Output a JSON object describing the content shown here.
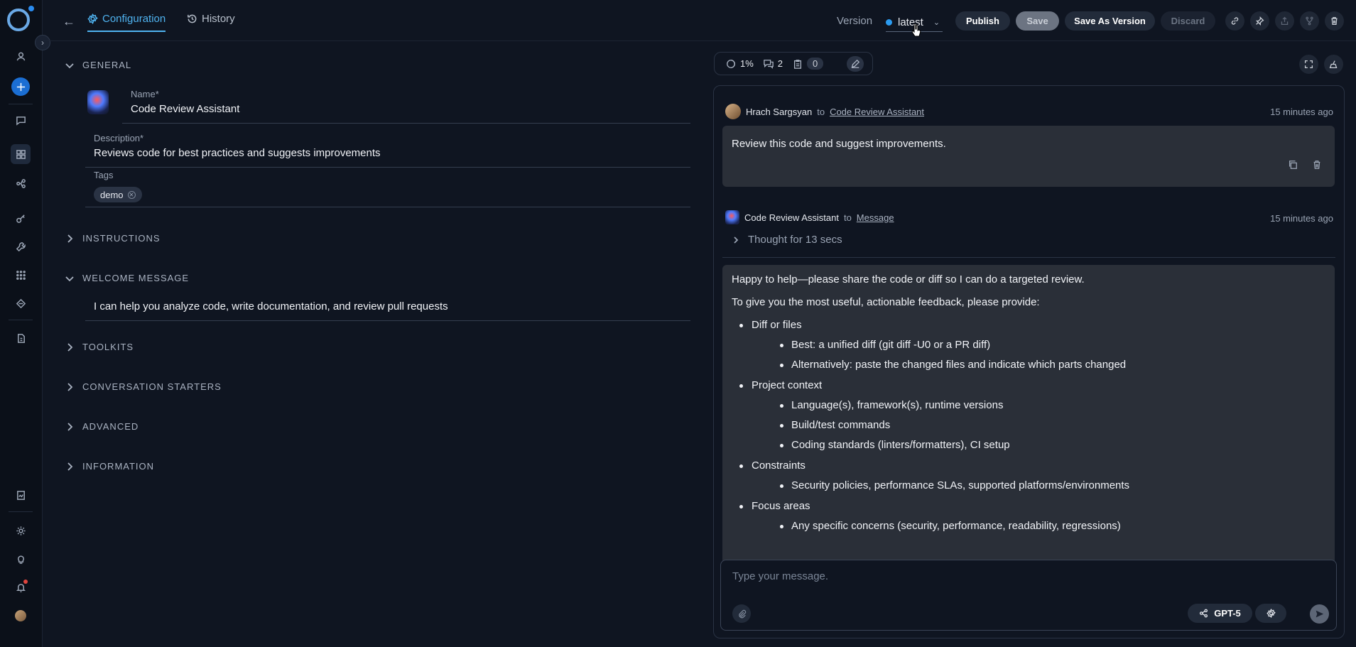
{
  "topbar": {
    "tabs": [
      {
        "label": "Configuration"
      },
      {
        "label": "History"
      }
    ],
    "version_label": "Version",
    "version_value": "latest",
    "buttons": {
      "publish": "Publish",
      "save": "Save",
      "save_as": "Save As Version",
      "discard": "Discard"
    }
  },
  "config": {
    "sections": {
      "general": "GENERAL",
      "instructions": "INSTRUCTIONS",
      "welcome": "WELCOME MESSAGE",
      "toolkits": "TOOLKITS",
      "starters": "CONVERSATION STARTERS",
      "advanced": "ADVANCED",
      "information": "INFORMATION"
    },
    "name_label": "Name",
    "name_value": "Code Review Assistant",
    "description_label": "Description",
    "description_value": "Reviews code for best practices and suggests improvements",
    "tags_label": "Tags",
    "tags": [
      "demo"
    ],
    "welcome_message": "I can help you analyze code, write documentation, and review pull requests",
    "required_mark": "*"
  },
  "chat_tools": {
    "context": "1%",
    "messages": "2",
    "attachments": "0"
  },
  "chat": {
    "user_message": {
      "author": "Hrach Sargsyan",
      "to": "to",
      "target": "Code Review Assistant",
      "time": "15 minutes ago",
      "text": "Review this code and suggest improvements."
    },
    "agent_message": {
      "author": "Code Review Assistant",
      "to": "to",
      "target": "Message",
      "time": "15 minutes ago",
      "thought": "Thought for 13 secs",
      "intro": "Happy to help—please share the code or diff so I can do a targeted review.",
      "lead": "To give you the most useful, actionable feedback, please provide:",
      "list": [
        {
          "title": "Diff or files",
          "items": [
            "Best: a unified diff (git diff -U0 or a PR diff)",
            "Alternatively: paste the changed files and indicate which parts changed"
          ]
        },
        {
          "title": "Project context",
          "items": [
            "Language(s), framework(s), runtime versions",
            "Build/test commands",
            "Coding standards (linters/formatters), CI setup"
          ]
        },
        {
          "title": "Constraints",
          "items": [
            "Security policies, performance SLAs, supported platforms/environments"
          ]
        },
        {
          "title": "Focus areas",
          "items": [
            "Any specific concerns (security, performance, readability, regressions)"
          ]
        }
      ]
    }
  },
  "composer": {
    "placeholder": "Type your message.",
    "model": "GPT-5"
  },
  "colors": {
    "accent": "#4fb3f0",
    "background": "#0f1521",
    "bubble": "#2a2f38",
    "brand_button": "#1b6ed3"
  }
}
